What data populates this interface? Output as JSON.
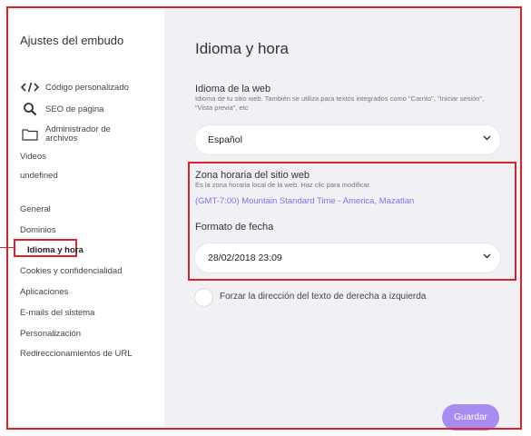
{
  "sidebar": {
    "title": "Ajustes del embudo",
    "tools": [
      {
        "label": "Código personalizado",
        "icon": "code-icon"
      },
      {
        "label": "SEO de página",
        "icon": "search-icon"
      },
      {
        "label": "Administrador de archivos",
        "icon": "folder-icon"
      }
    ],
    "extra": [
      "Videos",
      "undefined"
    ],
    "nav": [
      "General",
      "Dominios",
      "Idioma y hora",
      "Cookies y confidencialidad",
      "Aplicaciones",
      "E-mails del sistema",
      "Personalización",
      "Redireccionamientos de URL"
    ],
    "active_index": 2
  },
  "main": {
    "title": "Idioma y hora",
    "language": {
      "label": "Idioma de la web",
      "help": "Idioma de tu sitio web. También se utiliza para textos integrados como \"Carrito\", \"Iniciar sesión\", \"Vista previa\", etc",
      "value": "Español"
    },
    "timezone": {
      "label": "Zona horaria del sitio web",
      "help": "Es la zona horaria local de la web. Haz clic para modificar.",
      "value": "(GMT-7:00) Mountain Standard Time - America, Mazatlan"
    },
    "date_format": {
      "label": "Formato de fecha",
      "value": "28/02/2018 23:09"
    },
    "rtl_label": "Forzar la dirección del texto de derecha a izquierda",
    "save_label": "Guardar"
  },
  "colors": {
    "accent": "#a98cf0",
    "highlight": "#d9232d",
    "timezone_text": "#8a6fe0"
  }
}
